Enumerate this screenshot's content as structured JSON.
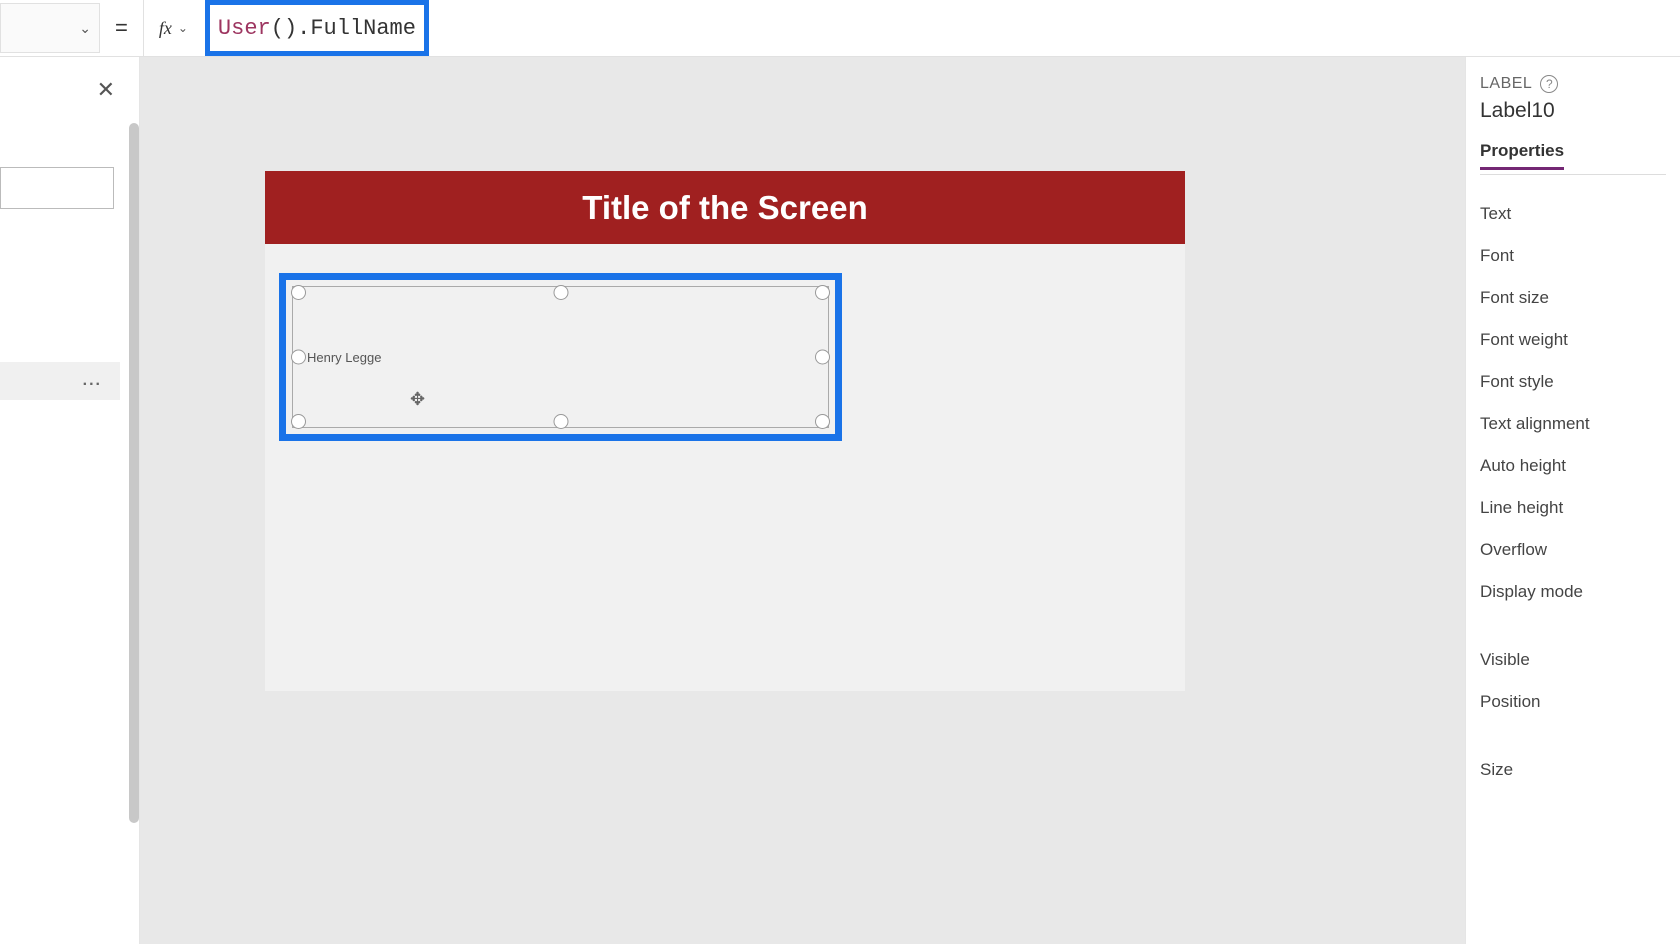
{
  "formula_bar": {
    "equals": "=",
    "fx": "fx",
    "formula_func": "User",
    "formula_prop": "FullName"
  },
  "canvas": {
    "screen_title": "Title of the Screen",
    "label_text": "Henry Legge"
  },
  "right_panel": {
    "heading": "LABEL",
    "element_name": "Label10",
    "tab": "Properties",
    "props": {
      "text": "Text",
      "font": "Font",
      "font_size": "Font size",
      "font_weight": "Font weight",
      "font_style": "Font style",
      "text_alignment": "Text alignment",
      "auto_height": "Auto height",
      "line_height": "Line height",
      "overflow": "Overflow",
      "display_mode": "Display mode",
      "visible": "Visible",
      "position": "Position",
      "size": "Size"
    }
  },
  "tree": {
    "more": "..."
  }
}
